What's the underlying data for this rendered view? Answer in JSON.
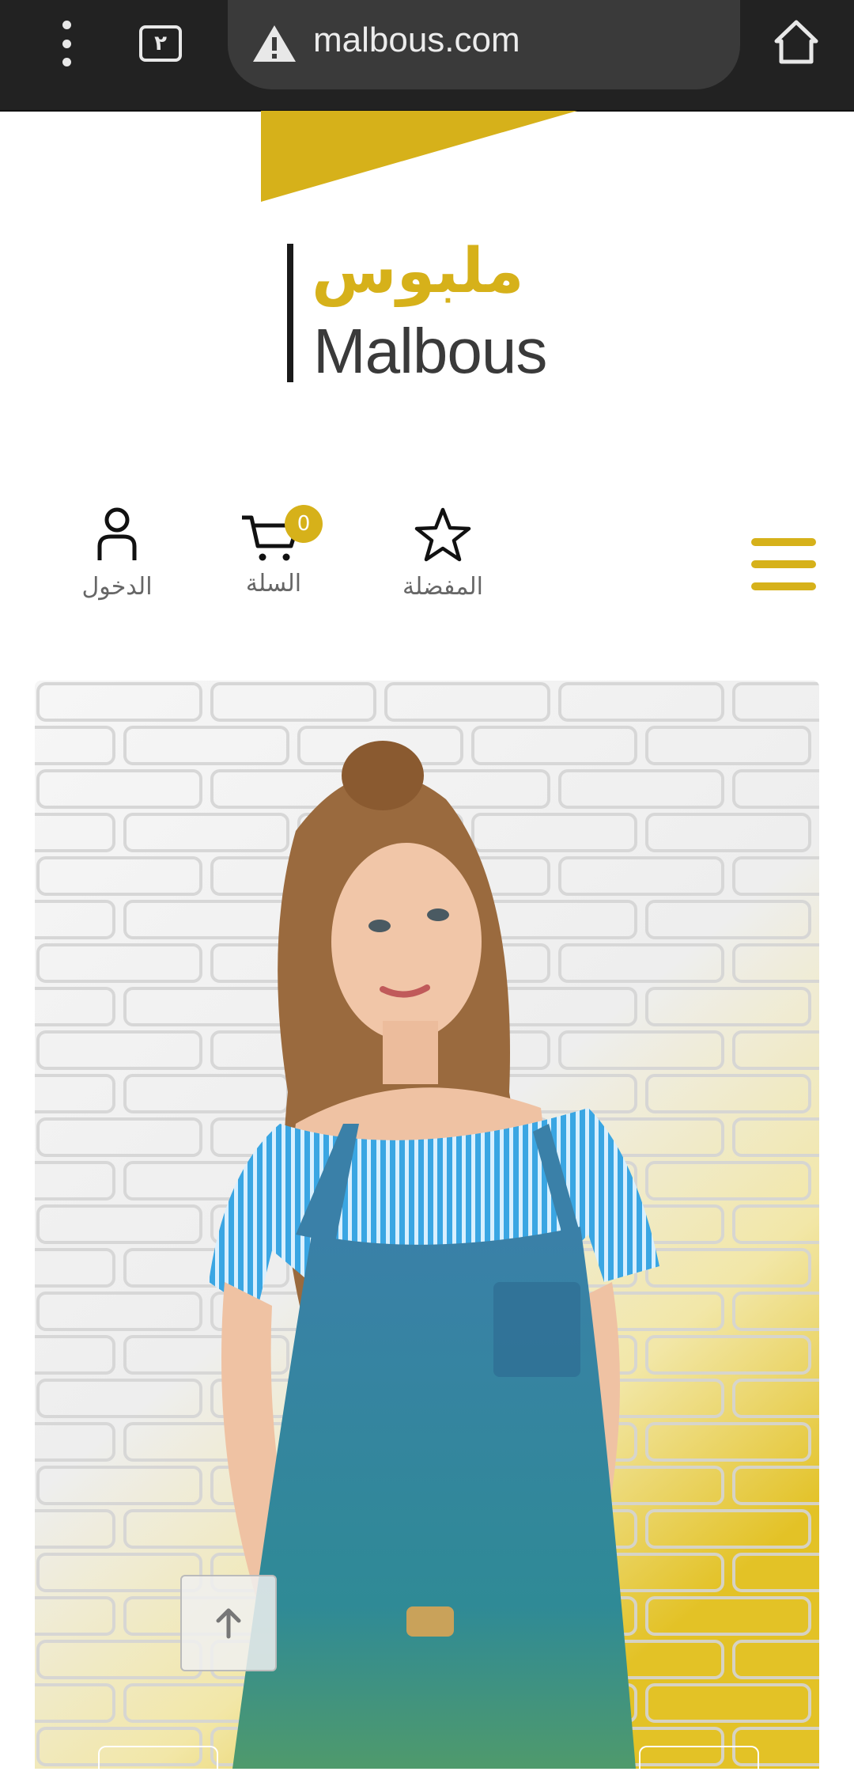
{
  "browser": {
    "tab_count": "٢",
    "url": "malbous.com",
    "security_icon": "warning-icon",
    "home_icon": "home-icon"
  },
  "logo": {
    "arabic": "ملبوس",
    "latin": "Malbous"
  },
  "nav": {
    "login_label": "الدخول",
    "cart_label": "السلة",
    "cart_count": "0",
    "favorites_label": "المفضلة",
    "menu_icon": "hamburger-menu-icon"
  },
  "colors": {
    "accent": "#d6b11a",
    "browser_bar": "#222222",
    "url_pill": "#3a3a3a"
  }
}
